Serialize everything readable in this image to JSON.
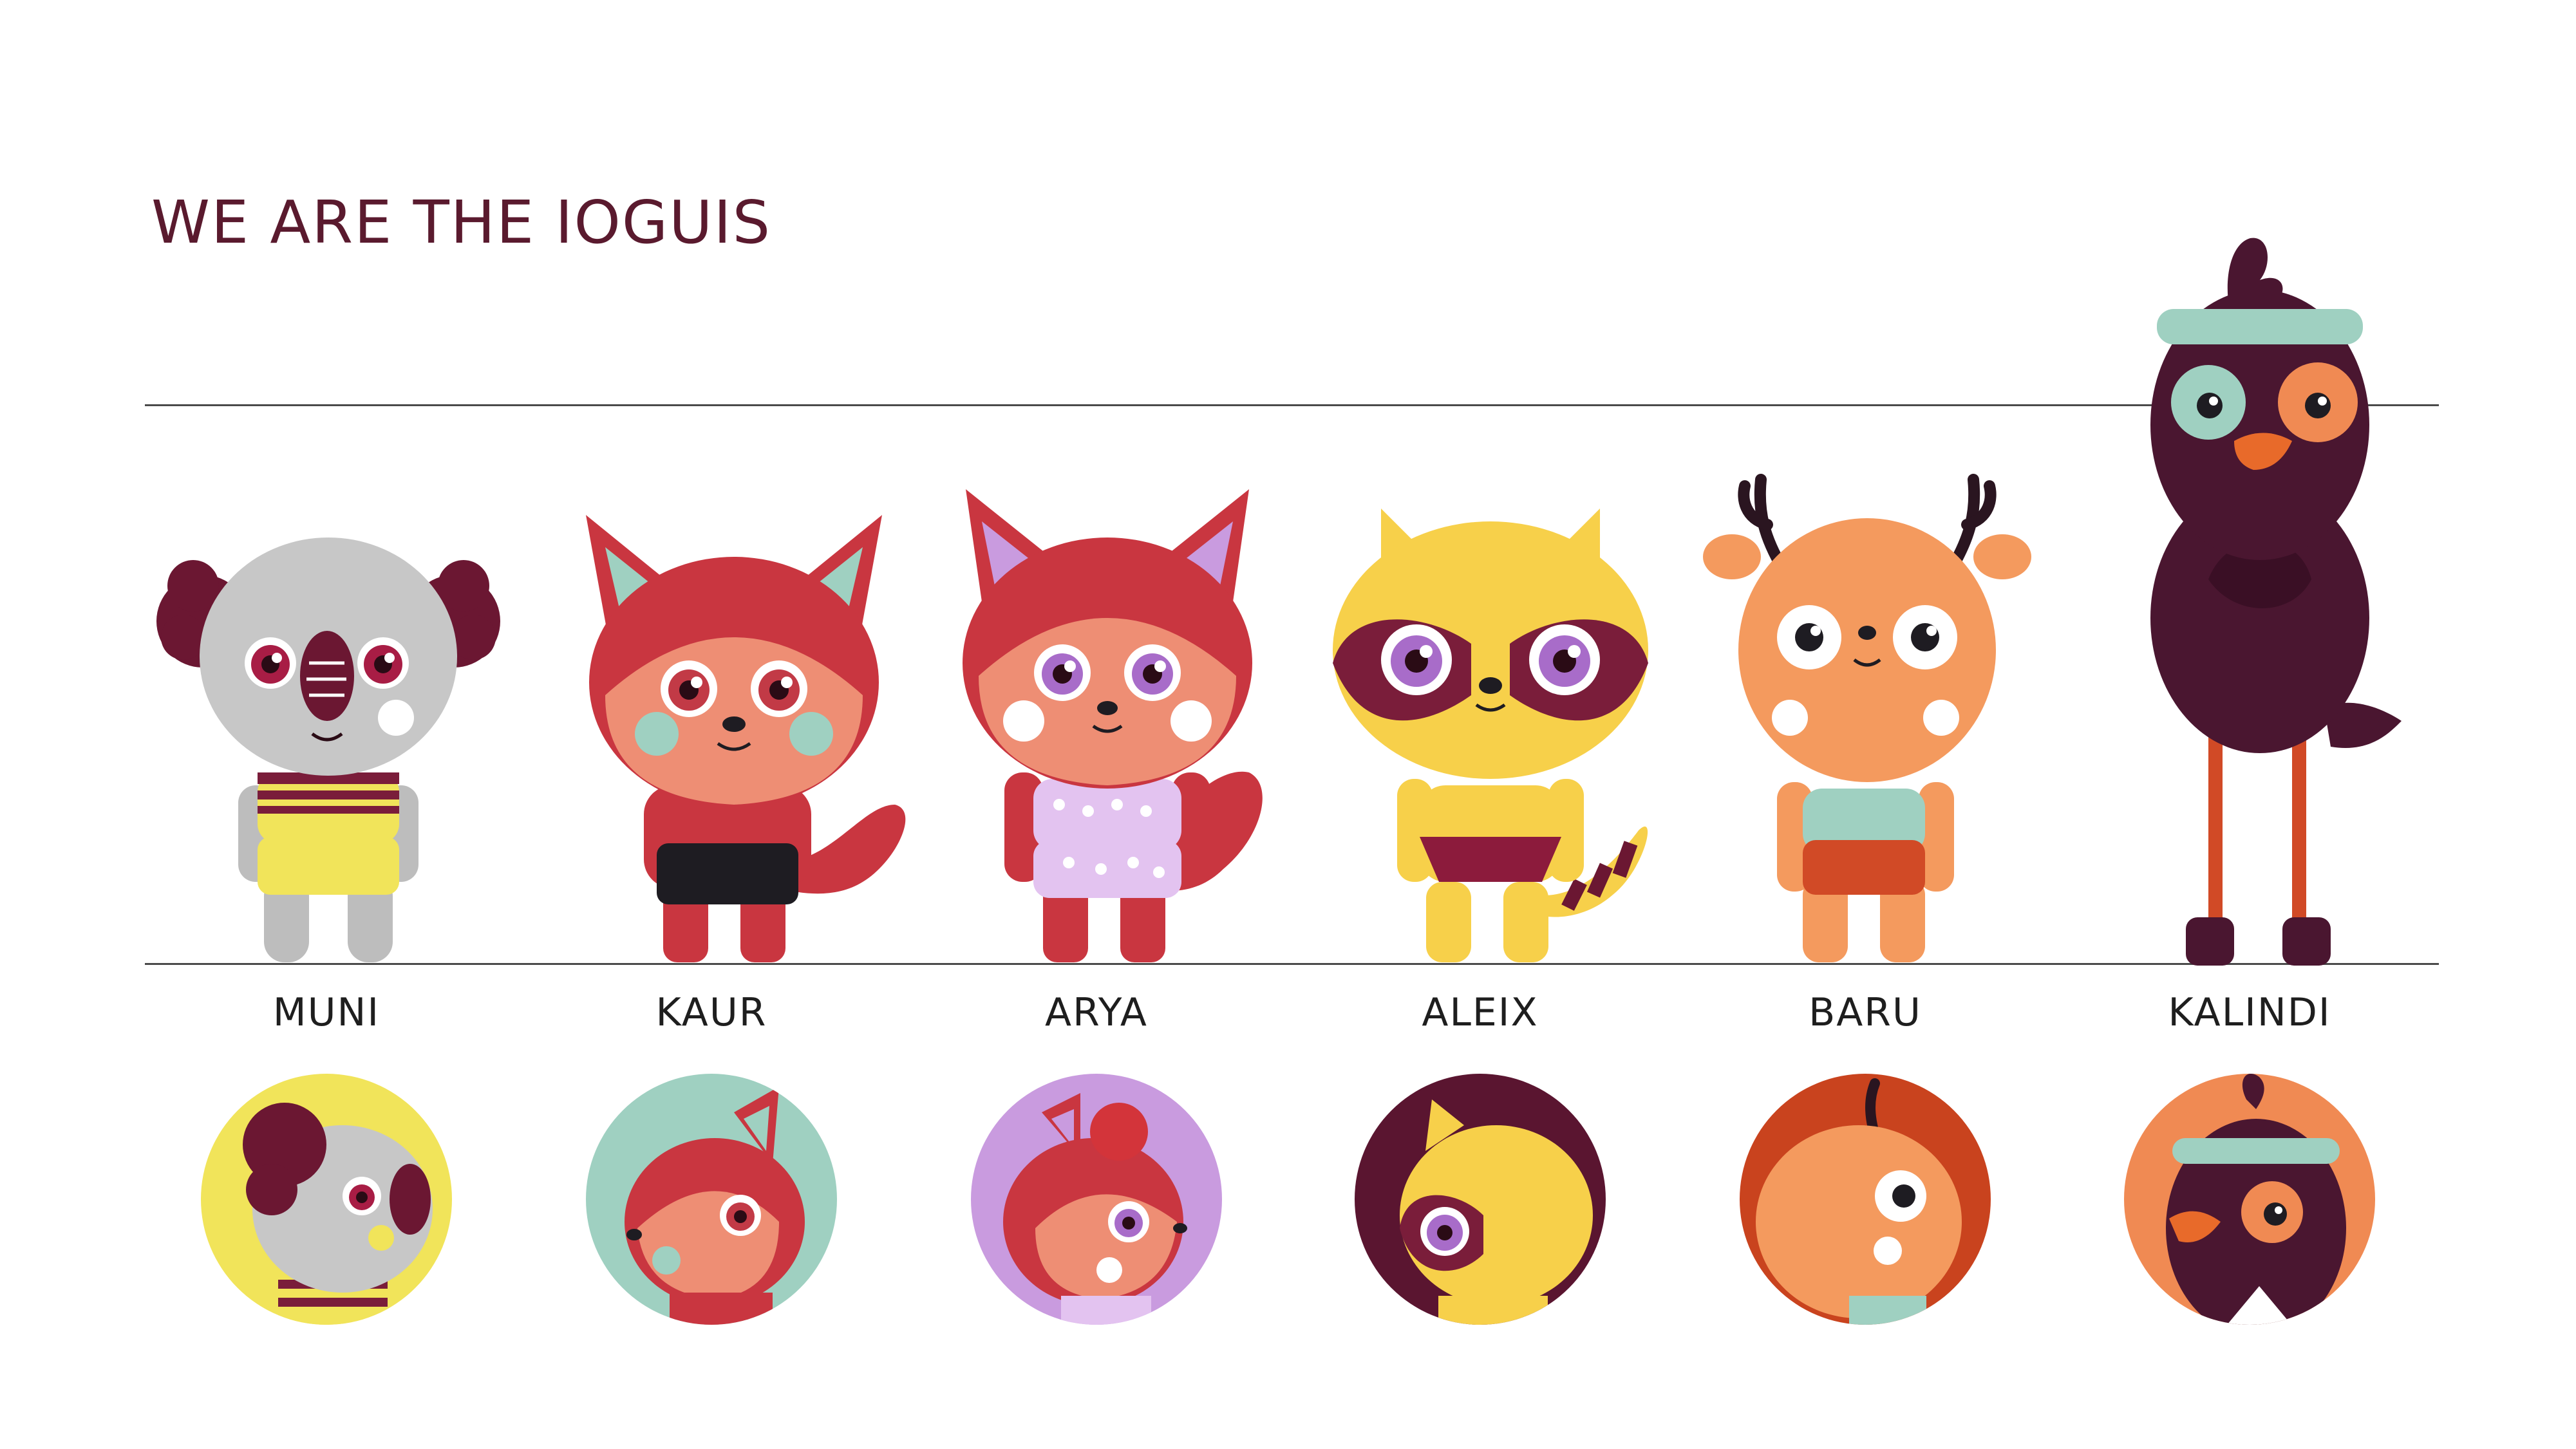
{
  "title": "WE ARE THE IOGUIS",
  "characters": [
    {
      "name": "MUNI",
      "animal": "koala",
      "avatar_bg": "#f1e45a"
    },
    {
      "name": "KAUR",
      "animal": "fox",
      "avatar_bg": "#9fd0c1"
    },
    {
      "name": "ARYA",
      "animal": "squirrel",
      "avatar_bg": "#c99bdf"
    },
    {
      "name": "ALEIX",
      "animal": "raccoon",
      "avatar_bg": "#5a1530"
    },
    {
      "name": "BARU",
      "animal": "deer",
      "avatar_bg": "#c9431e"
    },
    {
      "name": "KALINDI",
      "animal": "bird",
      "avatar_bg": "#f08a53"
    }
  ],
  "colors": {
    "title_text": "#5a1a2e",
    "rule": "#4a4a4a",
    "maroon": "#6b1732",
    "red": "#d3343a",
    "salmon": "#ee8e74",
    "mint": "#9fd0c1",
    "yellow": "#f7d04a",
    "orange": "#f49a5e",
    "grey": "#c7c7c7"
  }
}
